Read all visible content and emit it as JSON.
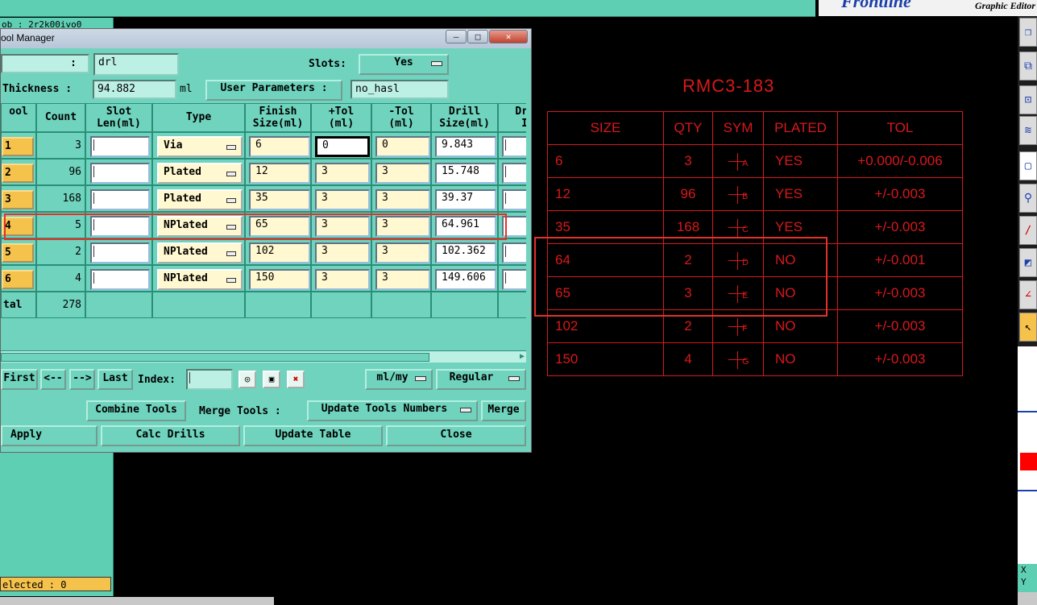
{
  "app": {
    "brand_logo": "Frontline",
    "brand_subtitle": "Graphic Editor",
    "partial_panel_text": "ob : 2r2k00ivo0",
    "selected_status": "elected : 0"
  },
  "window": {
    "title": "ool Manager",
    "minimize": "—",
    "maximize": "□",
    "close": "✕"
  },
  "top_fields": {
    "layer_label": ":",
    "layer_value": "drl",
    "slots_label": "Slots:",
    "slots_value": "Yes",
    "thickness_label": "Thickness :",
    "thickness_value": "94.882",
    "thickness_unit": "ml",
    "user_params_label": "User Parameters :",
    "user_params_value": "no_hasl"
  },
  "table": {
    "headers": {
      "tool": "ool",
      "count": "Count",
      "slot1": "Slot",
      "slot2": "Len(ml)",
      "type": "Type",
      "finish1": "Finish",
      "finish2": "Size(ml)",
      "ptol1": "+Tol",
      "ptol2": "(ml)",
      "ntol1": "-Tol",
      "ntol2": "(ml)",
      "drill1": "Drill",
      "drill2": "Size(ml)",
      "dr1": "Dr",
      "dr2": "I"
    },
    "rows": [
      {
        "tool": "1",
        "count": "3",
        "type": "Via",
        "finish": "6",
        "ptol": "0",
        "ntol": "0",
        "drill": "9.843"
      },
      {
        "tool": "2",
        "count": "96",
        "type": "Plated",
        "finish": "12",
        "ptol": "3",
        "ntol": "3",
        "drill": "15.748"
      },
      {
        "tool": "3",
        "count": "168",
        "type": "Plated",
        "finish": "35",
        "ptol": "3",
        "ntol": "3",
        "drill": "39.37"
      },
      {
        "tool": "4",
        "count": "5",
        "type": "NPlated",
        "finish": "65",
        "ptol": "3",
        "ntol": "3",
        "drill": "64.961"
      },
      {
        "tool": "5",
        "count": "2",
        "type": "NPlated",
        "finish": "102",
        "ptol": "3",
        "ntol": "3",
        "drill": "102.362"
      },
      {
        "tool": "6",
        "count": "4",
        "type": "NPlated",
        "finish": "150",
        "ptol": "3",
        "ntol": "3",
        "drill": "149.606"
      }
    ],
    "total_label": "tal",
    "total_count": "278"
  },
  "nav": {
    "first": "First",
    "prev": "<--",
    "next": "-->",
    "last": "Last",
    "index_label": "Index:",
    "units": "ml/my",
    "mode": "Regular"
  },
  "actions": {
    "combine_tools": "Combine Tools",
    "merge_tools_label": "Merge Tools :",
    "update_tools_numbers": "Update Tools Numbers",
    "merge": "Merge",
    "apply": "Apply",
    "calc_drills": "Calc Drills",
    "update_table": "Update Table",
    "close": "Close"
  },
  "drawing": {
    "title": "RMC3-183",
    "headers": [
      "SIZE",
      "QTY",
      "SYM",
      "PLATED",
      "TOL"
    ],
    "rows": [
      {
        "size": "6",
        "qty": "3",
        "sym": "A",
        "plated": "YES",
        "tol": "+0.000/-0.006"
      },
      {
        "size": "12",
        "qty": "96",
        "sym": "B",
        "plated": "YES",
        "tol": "+/-0.003"
      },
      {
        "size": "35",
        "qty": "168",
        "sym": "C",
        "plated": "YES",
        "tol": "+/-0.003"
      },
      {
        "size": "64",
        "qty": "2",
        "sym": "D",
        "plated": "NO",
        "tol": "+/-0.001"
      },
      {
        "size": "65",
        "qty": "3",
        "sym": "E",
        "plated": "NO",
        "tol": "+/-0.003"
      },
      {
        "size": "102",
        "qty": "2",
        "sym": "F",
        "plated": "NO",
        "tol": "+/-0.003"
      },
      {
        "size": "150",
        "qty": "4",
        "sym": "G",
        "plated": "NO",
        "tol": "+/-0.003"
      }
    ]
  },
  "right_toolbar": {
    "xy_x": "X",
    "xy_y": "Y"
  },
  "colors": {
    "panel": "#6fd3bd",
    "tool_button": "#f5c24c",
    "drawing_red": "#d8191b",
    "highlight_box": "#e2322a"
  }
}
